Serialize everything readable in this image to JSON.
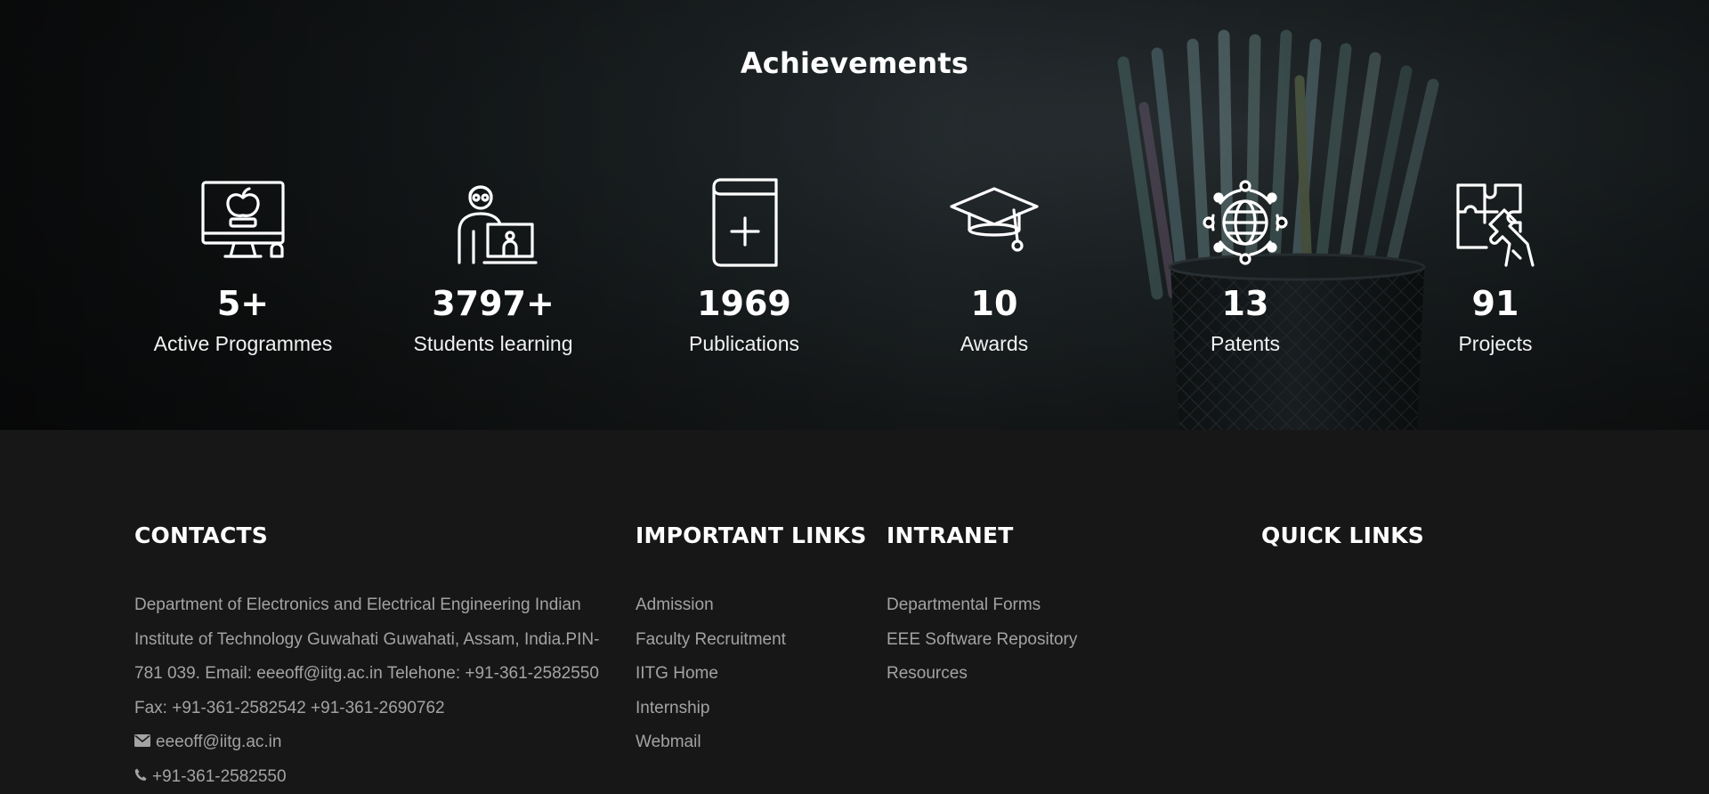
{
  "achievements": {
    "title": "Achievements",
    "stats": [
      {
        "value": "5+",
        "label": "Active Programmes",
        "icon": "computer-apple-icon"
      },
      {
        "value": "3797+",
        "label": "Students learning",
        "icon": "student-laptop-icon"
      },
      {
        "value": "1969",
        "label": "Publications",
        "icon": "book-plus-icon"
      },
      {
        "value": "10",
        "label": "Awards",
        "icon": "graduation-cap-icon"
      },
      {
        "value": "13",
        "label": "Patents",
        "icon": "globe-network-icon"
      },
      {
        "value": "91",
        "label": "Projects",
        "icon": "puzzle-icon"
      }
    ]
  },
  "footer": {
    "contacts": {
      "title": "CONTACTS",
      "address": "Department of Electronics and Electrical Engineering Indian Institute of Technology Guwahati Guwahati, Assam, India.PIN-781 039. Email: eeeoff@iitg.ac.in Telehone: +91-361-2582550 Fax: +91-361-2582542 +91-361-2690762",
      "email": "eeeoff@iitg.ac.in",
      "phone": "+91-361-2582550"
    },
    "important_links": {
      "title": "IMPORTANT LINKS",
      "items": [
        "Admission",
        "Faculty Recruitment",
        "IITG Home",
        "Internship",
        "Webmail"
      ]
    },
    "intranet": {
      "title": "INTRANET",
      "items": [
        "Departmental Forms",
        "EEE Software Repository",
        "Resources"
      ]
    },
    "quick_links": {
      "title": "QUICK LINKS"
    }
  },
  "colors": {
    "footer_bg": "#171717",
    "link_text": "#a3a3a3",
    "heading_text": "#ffffff"
  }
}
